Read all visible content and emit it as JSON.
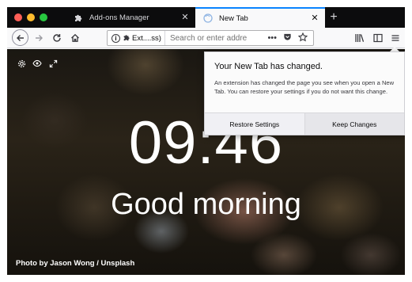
{
  "tabs": [
    {
      "label": "Add-ons Manager",
      "icon": "puzzle-icon"
    },
    {
      "label": "New Tab",
      "icon": "firefox-icon"
    }
  ],
  "urlbar": {
    "identity_label": "Ext....ss)",
    "placeholder": "Search or enter addre"
  },
  "content": {
    "clock": "09:46",
    "greeting": "Good morning",
    "photo_credit": "Photo by Jason Wong / Unsplash"
  },
  "panel": {
    "title": "Your New Tab has changed.",
    "body": "An extension has changed the page you see when you open a New Tab. You can restore your settings if you do not want this change.",
    "restore_label": "Restore Settings",
    "keep_label": "Keep Changes"
  },
  "colors": {
    "tabbar_bg": "#0c0c0d",
    "active_tab_accent": "#0a84ff",
    "toolbar_bg": "#f9f9fa"
  }
}
